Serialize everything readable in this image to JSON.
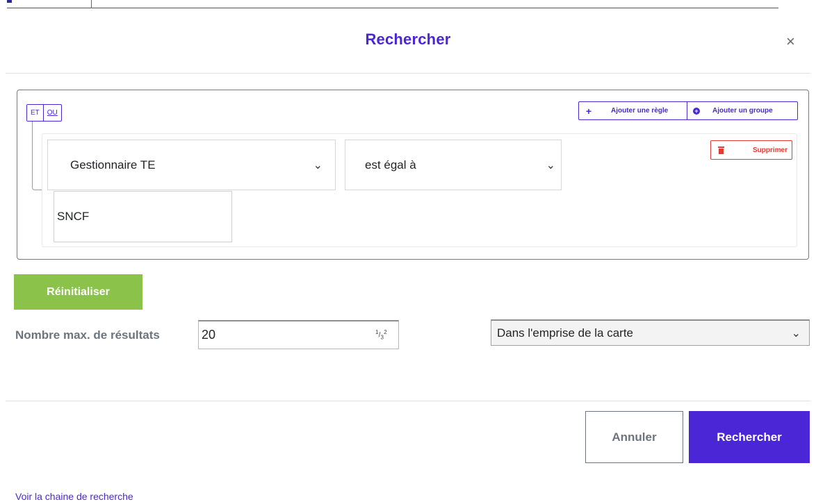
{
  "dialog": {
    "title": "Rechercher",
    "close_icon": "close-icon",
    "close_glyph": "×"
  },
  "query_builder": {
    "conditions": {
      "and_label": "ET",
      "or_label": "OU",
      "selected": "ET"
    },
    "add_rule_label": "Ajouter une règle",
    "add_group_label": "Ajouter un groupe",
    "rule": {
      "field": "Gestionnaire TE",
      "operator": "est égal à",
      "value": "SNCF",
      "delete_label": "Supprimer"
    }
  },
  "reset_label": "Réinitialiser",
  "max_results": {
    "label": "Nombre max. de résultats",
    "value": "20"
  },
  "extent_select": {
    "selected": "Dans l'emprise de la carte"
  },
  "see_chain_label": "Voir la chaine de recherche",
  "footer": {
    "cancel_label": "Annuler",
    "submit_label": "Rechercher"
  },
  "colors": {
    "accent": "#4b26d6",
    "danger": "#e53935",
    "success": "#8bc34a",
    "muted": "#6c757d"
  }
}
